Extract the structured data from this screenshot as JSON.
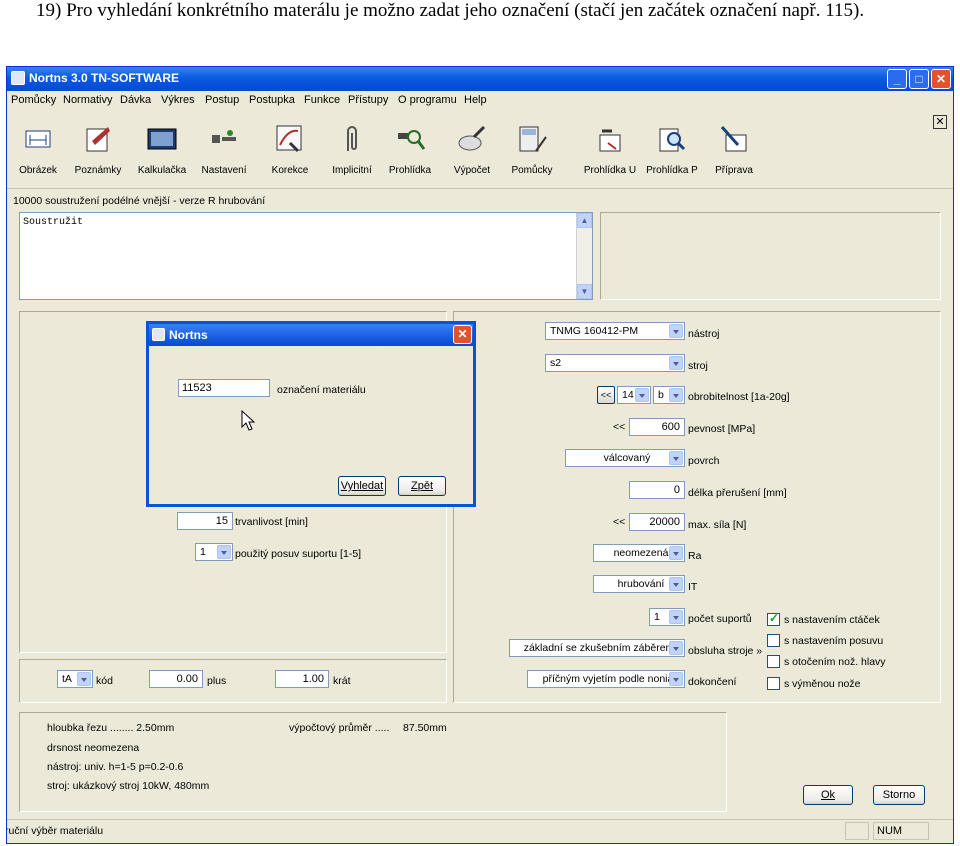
{
  "caption": "19)  Pro vyhledání konkrétního materálu je možno zadat jeho označení (stačí jen začátek označení např. 115).",
  "window": {
    "title": "Nortns 3.0 TN-SOFTWARE"
  },
  "menu": [
    "Pomůcky",
    "Normativy",
    "Dávka",
    "Výkres",
    "Postup",
    "Postupka",
    "Funkce",
    "Přístupy",
    "O programu",
    "Help"
  ],
  "toolbar": [
    "Obrázek",
    "Poznámky",
    "Kalkulačka",
    "Nastavení",
    "Korekce",
    "Implicitní",
    "Prohlídka",
    "Výpočet",
    "Pomůcky",
    "Prohlídka U",
    "Prohlídka P",
    "Příprava"
  ],
  "operation_title": "10000 soustružení podélné vnější - verze R hrubování",
  "operation_text": "Soustružit",
  "dialog": {
    "title": "Nortns",
    "material_value": "11523",
    "material_label": "označení materiálu",
    "search_button": "Vyhledat",
    "back_button": "Zpět"
  },
  "left": {
    "durability_value": "15",
    "durability_label": "trvanlivost [min]",
    "feed_value": "1",
    "feed_label": "použitý posuv suportu [1-5]",
    "code_value": "tA",
    "code_label": "kód",
    "plus_value": "0.00",
    "plus_label": "plus",
    "times_value": "1.00",
    "times_label": "krát"
  },
  "right": {
    "tool_value": "TNMG 160412-PM",
    "tool_label": "nástroj",
    "machine_value": "s2",
    "machine_label": "stroj",
    "mach_btn": "<<",
    "mach_num": "14",
    "mach_letter": "b",
    "machinability_label": "obrobitelnost [1a-20g]",
    "strength_marker": "<<",
    "strength_value": "600",
    "strength_label": "pevnost [MPa]",
    "surface_value": "válcovaný",
    "surface_label": "povrch",
    "interrupt_value": "0",
    "interrupt_label": "délka přerušení [mm]",
    "force_marker": "<<",
    "force_value": "20000",
    "force_label": "max. síla [N]",
    "ra_value": "neomezená",
    "ra_label": "Ra",
    "it_value": "hrubování",
    "it_label": "IT",
    "supports_value": "1",
    "supports_label": "počet suportů",
    "operation_value": "základní se zkušebním záběrem",
    "operation_label": "obsluha stroje »",
    "finish_value": "příčným vyjetím podle nonia",
    "finish_label": "dokončení",
    "checks": [
      {
        "label": "s nastavením ctáček",
        "checked": true
      },
      {
        "label": "s nastavením posuvu",
        "checked": false
      },
      {
        "label": "s otočením nož. hlavy",
        "checked": false
      },
      {
        "label": "s výměnou nože",
        "checked": false
      }
    ]
  },
  "summary": {
    "line1": "hloubka řezu ........ 2.50mm",
    "line1b": "výpočtový průměr .....",
    "line1c": "87.50mm",
    "line2": "drsnost neomezena",
    "line3": "nástroj: univ. h=1-5 p=0.2-0.6",
    "line4": "stroj: ukázkový stroj 10kW, 480mm"
  },
  "buttons": {
    "ok": "Ok",
    "cancel": "Storno"
  },
  "status": {
    "text": "ruční výběr materiálu",
    "num": "NUM"
  },
  "colors": {
    "titlebar": "#0a5be3",
    "face": "#ece9d8",
    "close": "#e2532d"
  }
}
